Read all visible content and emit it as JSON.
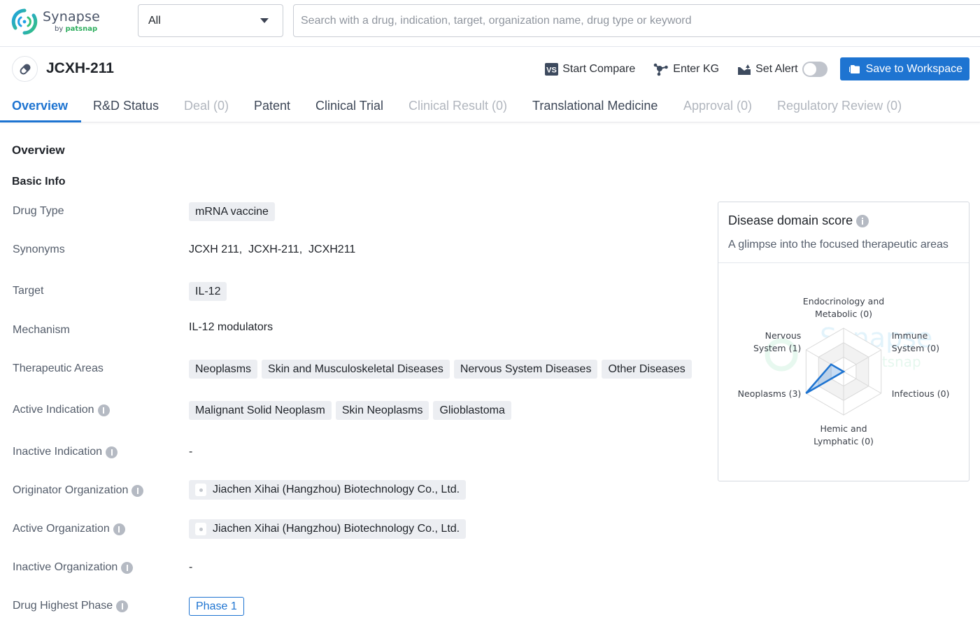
{
  "app": {
    "name": "Synapse",
    "by": "by",
    "brand": "patsnap"
  },
  "search": {
    "scope_value": "All",
    "placeholder": "Search with a drug, indication, target, organization name, drug type or keyword",
    "value": ""
  },
  "drug": {
    "title": "JCXH-211",
    "icon": "pill-icon"
  },
  "actions": {
    "compare_label": "Start Compare",
    "kg_label": "Enter KG",
    "alert_label": "Set Alert",
    "alert_enabled": false,
    "save_label": "Save to Workspace"
  },
  "tabs": [
    {
      "label": "Overview",
      "state": "active"
    },
    {
      "label": "R&D Status",
      "state": "normal"
    },
    {
      "label": "Deal (0)",
      "state": "disabled"
    },
    {
      "label": "Patent",
      "state": "normal"
    },
    {
      "label": "Clinical Trial",
      "state": "normal"
    },
    {
      "label": "Clinical Result (0)",
      "state": "disabled"
    },
    {
      "label": "Translational Medicine",
      "state": "normal"
    },
    {
      "label": "Approval (0)",
      "state": "disabled"
    },
    {
      "label": "Regulatory Review (0)",
      "state": "disabled"
    }
  ],
  "overview": {
    "heading": "Overview",
    "basic_info_heading": "Basic Info",
    "rows": {
      "drug_type": {
        "label": "Drug Type",
        "tags": [
          "mRNA vaccine"
        ]
      },
      "synonyms": {
        "label": "Synonyms",
        "text": "JCXH 211,  JCXH-211,  JCXH211"
      },
      "target": {
        "label": "Target",
        "tags": [
          "IL-12"
        ]
      },
      "mechanism": {
        "label": "Mechanism",
        "text": "IL-12 modulators"
      },
      "therapeutic_areas": {
        "label": "Therapeutic Areas",
        "tags": [
          "Neoplasms",
          "Skin and Musculoskeletal Diseases",
          "Nervous System Diseases",
          "Other Diseases"
        ]
      },
      "active_indication": {
        "label": "Active Indication",
        "tags": [
          "Malignant Solid Neoplasm",
          "Skin Neoplasms",
          "Glioblastoma"
        ]
      },
      "inactive_indication": {
        "label": "Inactive Indication",
        "text": "-"
      },
      "originator_org": {
        "label": "Originator Organization",
        "org": "Jiachen Xihai (Hangzhou) Biotechnology Co., Ltd."
      },
      "active_org": {
        "label": "Active Organization",
        "org": "Jiachen Xihai (Hangzhou) Biotechnology Co., Ltd."
      },
      "inactive_org": {
        "label": "Inactive Organization",
        "text": "-"
      },
      "highest_phase": {
        "label": "Drug Highest Phase",
        "phase": "Phase 1"
      }
    }
  },
  "disease_card": {
    "title": "Disease domain score",
    "subtitle": "A glimpse into the focused therapeutic areas"
  },
  "colors": {
    "accent": "#1e74d1",
    "logo_green": "#2fae5f"
  },
  "chart_data": {
    "type": "radar",
    "title": "Disease domain score",
    "axes": [
      {
        "label_lines": [
          "Endocrinology and",
          "Metabolic (0)"
        ],
        "name": "Endocrinology and Metabolic",
        "value": 0
      },
      {
        "label_lines": [
          "Immune",
          "System (0)"
        ],
        "name": "Immune System",
        "value": 0
      },
      {
        "label_lines": [
          "Infectious (0)"
        ],
        "name": "Infectious",
        "value": 0
      },
      {
        "label_lines": [
          "Hemic and",
          "Lymphatic (0)"
        ],
        "name": "Hemic and Lymphatic",
        "value": 0
      },
      {
        "label_lines": [
          "Neoplasms (3)"
        ],
        "name": "Neoplasms",
        "value": 3
      },
      {
        "label_lines": [
          "Nervous",
          "System (1)"
        ],
        "name": "Nervous System",
        "value": 1
      }
    ],
    "max": 3,
    "rings": 3,
    "series_color": "#1e74d1"
  }
}
